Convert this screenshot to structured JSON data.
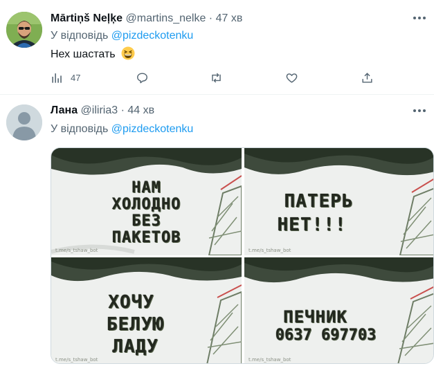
{
  "tweets": [
    {
      "name": "Mārtiņš Neļķe",
      "handle": "@martins_nelke",
      "separator": "·",
      "time": "47 хв",
      "reply_prefix": "У відповідь",
      "reply_to": "@pizdeckotenku",
      "text": "Нех шастать",
      "emoji": "grinning-squinting-face",
      "actions": {
        "views": "47",
        "reply": "",
        "retweet": "",
        "like": "",
        "share": ""
      }
    },
    {
      "name": "Лана",
      "handle": "@iliria3",
      "separator": "·",
      "time": "44 хв",
      "reply_prefix": "У відповідь",
      "reply_to": "@pizdeckotenku",
      "media": [
        {
          "lines": [
            "НАМ",
            "ХОЛОДНО",
            "БЕЗ",
            "ПАКЕТОВ"
          ],
          "watermark": "t.me/s_tshaw_bot"
        },
        {
          "lines": [
            "ПАТЕРЬ",
            "НЕТ!!!"
          ],
          "watermark": "t.me/s_tshaw_bot"
        },
        {
          "lines": [
            "ХОЧУ",
            "БЕЛУЮ",
            "ЛАДУ"
          ],
          "watermark": "t.me/s_tshaw_bot"
        },
        {
          "lines": [
            "ПЕЧНИК",
            "0637 697703"
          ],
          "watermark": "t.me/s_tshaw_bot"
        }
      ]
    }
  ],
  "colors": {
    "link": "#1d9bf0",
    "secondary_text": "#536471",
    "divider": "#eff3f4",
    "default_avatar": "#cfd9de"
  }
}
